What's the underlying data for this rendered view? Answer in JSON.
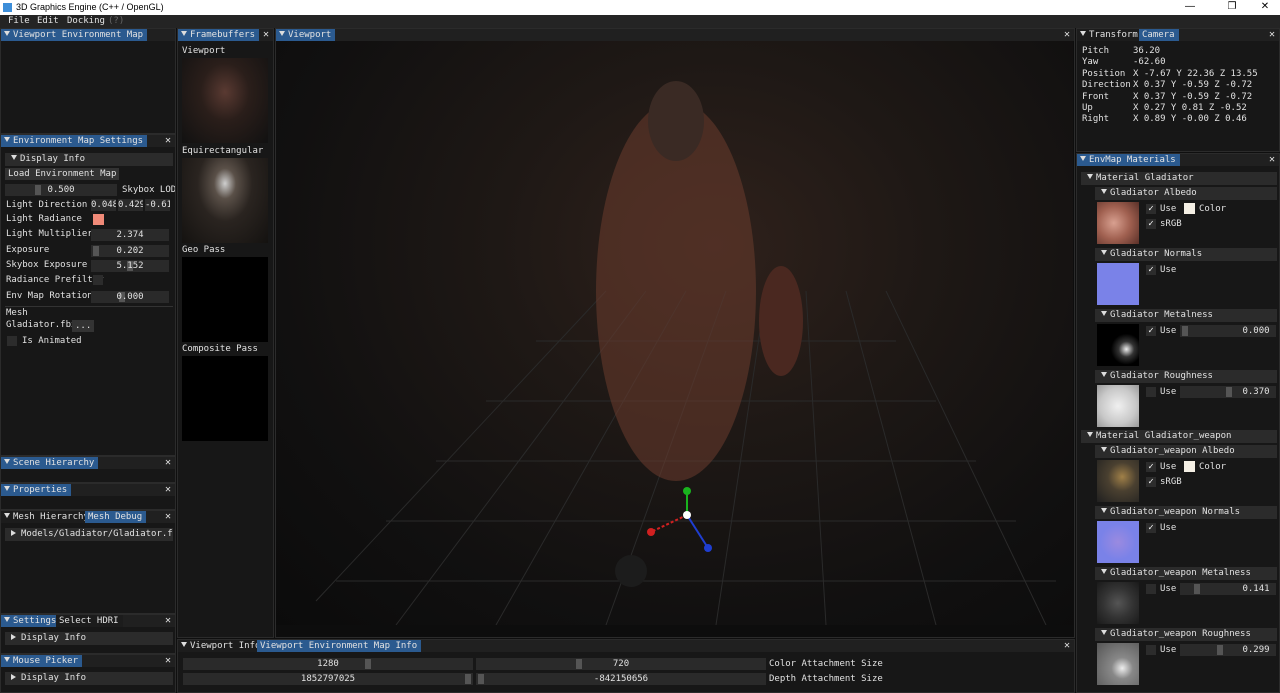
{
  "window": {
    "title": "3D Graphics Engine (C++ / OpenGL)",
    "min": "—",
    "restore": "❐",
    "close": "✕"
  },
  "menu": {
    "file": "File",
    "edit": "Edit",
    "docking": "Docking",
    "help": "(?)"
  },
  "panels": {
    "viewport_env_map": {
      "title": "Viewport Environment Map"
    },
    "env_settings": {
      "title": "Environment Map Settings",
      "display_info": "Display Info",
      "load_button": "Load Environment Map",
      "skybox_lod": {
        "value": "0.500",
        "label": "Skybox LOD"
      },
      "light_direction": {
        "label": "Light Direction",
        "x": "0.048",
        "y": "0.429",
        "z": "-0.61"
      },
      "light_radiance": {
        "label": "Light Radiance",
        "color": "#f08a78"
      },
      "light_multiplier": {
        "label": "Light Multiplier",
        "value": "2.374"
      },
      "exposure": {
        "label": "Exposure",
        "value": "0.202"
      },
      "skybox_exposure": {
        "label": "Skybox Exposure Fa",
        "value": "5.152"
      },
      "radiance_prefilter": {
        "label": "Radiance Prefilter"
      },
      "env_rotation": {
        "label": "Env Map Rotation",
        "value": "0.000"
      },
      "mesh_label": "Mesh",
      "mesh_file": "Gladiator.fbx",
      "mesh_browse": "...",
      "is_animated": "Is Animated"
    },
    "scene_hierarchy": {
      "title": "Scene Hierarchy"
    },
    "properties": {
      "title": "Properties"
    },
    "mesh": {
      "tab1": "Mesh Hierarchy",
      "tab2": "Mesh Debug",
      "item": "Models/Gladiator/Gladiator.fbx"
    },
    "settings": {
      "tab1": "Settings",
      "tab2": "Select HDRI",
      "display_info": "Display Info"
    },
    "mouse_picker": {
      "title": "Mouse Picker",
      "display_info": "Display Info"
    },
    "framebuffers": {
      "title": "Framebuffers",
      "viewport": "Viewport",
      "equirect": "Equirectangular",
      "geo": "Geo Pass",
      "composite": "Composite Pass"
    },
    "viewport": {
      "title": "Viewport"
    },
    "info": {
      "tab1": "Viewport Info",
      "tab2": "Viewport Environment Map Info",
      "color_w": "1280",
      "color_h": "720",
      "color_label": "Color Attachment Size",
      "depth_w": "1852797025",
      "depth_h": "-842150656",
      "depth_label": "Depth Attachment Size"
    },
    "transform": {
      "tab1": "Transform",
      "tab2": "Camera",
      "rows": [
        {
          "k": "Pitch",
          "v": "36.20"
        },
        {
          "k": "Yaw",
          "v": "-62.60"
        },
        {
          "k": "Position",
          "v": "X -7.67 Y 22.36 Z 13.55"
        },
        {
          "k": "Direction",
          "v": "X 0.37 Y -0.59 Z -0.72"
        },
        {
          "k": "Front",
          "v": "X 0.37 Y -0.59 Z -0.72"
        },
        {
          "k": "Up",
          "v": "X 0.27 Y 0.81 Z -0.52"
        },
        {
          "k": "Right",
          "v": "X 0.89 Y -0.00 Z 0.46"
        }
      ]
    },
    "materials": {
      "title": "EnvMap Materials",
      "mat1": "Material Gladiator",
      "albedo1": "Gladiator Albedo",
      "normals1": "Gladiator Normals",
      "metal1": "Gladiator Metalness",
      "rough1": "Gladiator Roughness",
      "mat2": "Material Gladiator_weapon",
      "albedo2": "Gladiator_weapon Albedo",
      "normals2": "Gladiator_weapon Normals",
      "metal2": "Gladiator_weapon Metalness",
      "rough2": "Gladiator_weapon Roughness",
      "use": "Use",
      "color": "Color",
      "srgb": "sRGB",
      "metal1_val": "0.000",
      "rough1_val": "0.370",
      "metal2_val": "0.141",
      "rough2_val": "0.299",
      "check": "✓"
    }
  },
  "colors": {
    "accent": "#2b5a8f",
    "panel": "#171717",
    "field": "#2a2a2a"
  }
}
